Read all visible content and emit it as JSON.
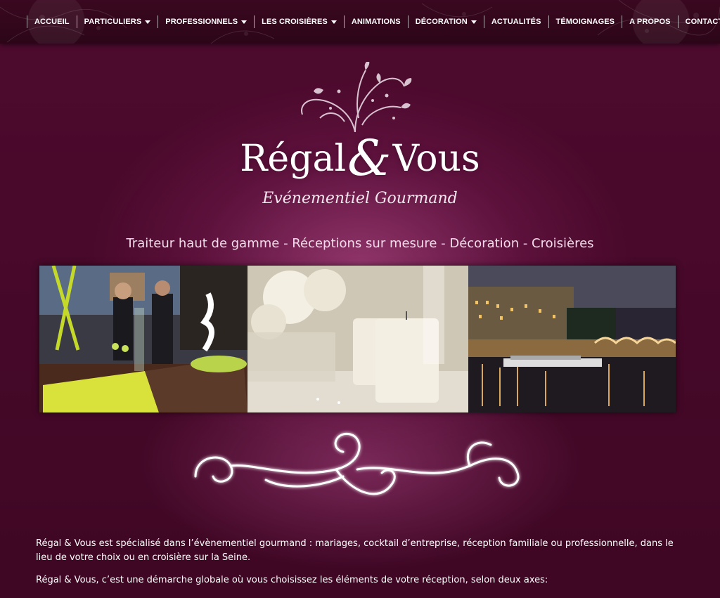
{
  "nav": {
    "items": [
      {
        "label": "ACCUEIL",
        "dropdown": false
      },
      {
        "label": "PARTICULIERS",
        "dropdown": true
      },
      {
        "label": "PROFESSIONNELS",
        "dropdown": true
      },
      {
        "label": "LES CROISIÈRES",
        "dropdown": true
      },
      {
        "label": "ANIMATIONS",
        "dropdown": false
      },
      {
        "label": "DÉCORATION",
        "dropdown": true
      },
      {
        "label": "ACTUALITÉS",
        "dropdown": false
      },
      {
        "label": "TÉMOIGNAGES",
        "dropdown": false
      },
      {
        "label": "A PROPOS",
        "dropdown": false
      },
      {
        "label": "CONTACT",
        "dropdown": false
      }
    ]
  },
  "header": {
    "brand_left": "Régal",
    "brand_amp": "&",
    "brand_right": "Vous",
    "tagline": "Evénementiel Gourmand",
    "services": "Traiteur haut de gamme - Réceptions sur mesure - Décoration - Croisières"
  },
  "photos": [
    {
      "icon": "buffet-photo"
    },
    {
      "icon": "candles-roses-photo"
    },
    {
      "icon": "seine-night-photo"
    }
  ],
  "content": {
    "paragraph_1": "Régal & Vous est spécialisé dans l’évènementiel gourmand : mariages, cocktail d’entreprise, réception familiale ou professionnelle, dans le lieu de votre choix ou en croisière sur la Seine.",
    "paragraph_2": "Régal & Vous, c’est une démarche globale où vous choisissez les éléments de votre réception, selon deux axes:"
  },
  "colors": {
    "background": "#4e0a2e",
    "nav_background": "#2c0618",
    "glow": "#cd5aa0",
    "text": "#ffffff"
  }
}
